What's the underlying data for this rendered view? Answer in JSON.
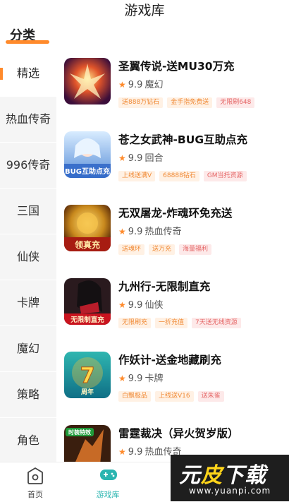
{
  "header": {
    "title": "游戏库"
  },
  "category_heading": "分类",
  "sidebar": {
    "items": [
      {
        "label": "精选",
        "active": true
      },
      {
        "label": "热血传奇",
        "active": false
      },
      {
        "label": "996传奇",
        "active": false
      },
      {
        "label": "三国",
        "active": false
      },
      {
        "label": "仙侠",
        "active": false
      },
      {
        "label": "卡牌",
        "active": false
      },
      {
        "label": "魔幻",
        "active": false
      },
      {
        "label": "策略",
        "active": false
      },
      {
        "label": "角色",
        "active": false
      }
    ]
  },
  "games": [
    {
      "title": "圣翼传说-送MU30万充",
      "rating": "9.9",
      "genre": "魔幻",
      "tags": [
        {
          "text": "送888万钻石",
          "style": "orange"
        },
        {
          "text": "金手指免费送",
          "style": "orange"
        },
        {
          "text": "无限刷648",
          "style": "red"
        }
      ]
    },
    {
      "title": "苍之女武神-BUG互助点充",
      "rating": "9.9",
      "genre": "回合",
      "tags": [
        {
          "text": "上线送满V",
          "style": "orange"
        },
        {
          "text": "68888钻石",
          "style": "orange"
        },
        {
          "text": "GM当托资源",
          "style": "red"
        }
      ]
    },
    {
      "title": "无双屠龙-炸魂环免充送",
      "rating": "9.9",
      "genre": "热血传奇",
      "tags": [
        {
          "text": "送魂环",
          "style": "orange"
        },
        {
          "text": "送万充",
          "style": "orange"
        },
        {
          "text": "海量福利",
          "style": "red"
        }
      ]
    },
    {
      "title": "九州行-无限制直充",
      "rating": "9.9",
      "genre": "仙侠",
      "tags": [
        {
          "text": "无限刷充",
          "style": "orange"
        },
        {
          "text": "一折充值",
          "style": "orange"
        },
        {
          "text": "7天送无线资源",
          "style": "red"
        }
      ]
    },
    {
      "title": "作妖计-送金地藏刷充",
      "rating": "9.9",
      "genre": "卡牌",
      "tags": [
        {
          "text": "白飘极品",
          "style": "orange"
        },
        {
          "text": "上线送V16",
          "style": "orange"
        },
        {
          "text": "送朱雀",
          "style": "red"
        }
      ]
    },
    {
      "title": "雷霆裁决（异火贺岁版）",
      "rating": "9.9",
      "genre": "热血传奇",
      "tags": []
    }
  ],
  "icon_labels": [
    "BUG互助点充",
    "领真充",
    "无限制直充",
    "周年",
    "时装特效"
  ],
  "bottom_nav": {
    "tabs": [
      {
        "label": "首页",
        "icon": "home-icon",
        "active": false
      },
      {
        "label": "游戏库",
        "icon": "gamepad-icon",
        "active": true
      }
    ]
  },
  "watermark": {
    "text_left": "元",
    "text_accent": "皮",
    "text_right": "下载",
    "url": "www.yuanpi.com"
  },
  "colors": {
    "accent": "#ff8a2b",
    "tag_orange": "#f08a36",
    "tag_red": "#e56666",
    "active_tab": "#2ab5b0"
  }
}
